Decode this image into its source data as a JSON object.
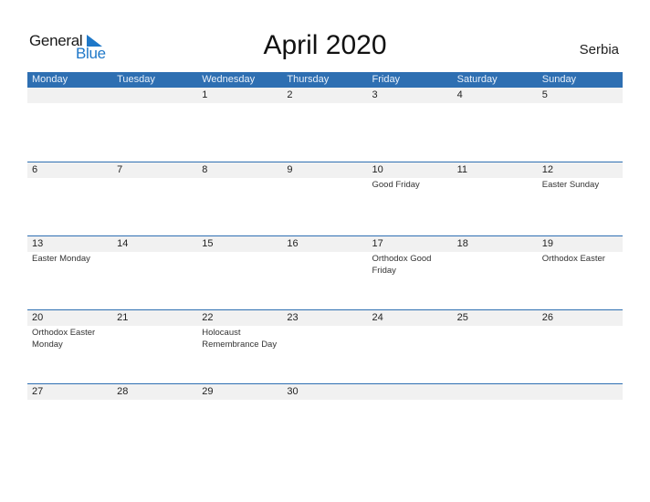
{
  "logo": {
    "part1": "General",
    "part2": "Blue"
  },
  "title": "April 2020",
  "country": "Serbia",
  "colors": {
    "accent": "#2e6fb2",
    "strip": "#f1f1f1",
    "logo_blue": "#1f78c8"
  },
  "weekdays": [
    "Monday",
    "Tuesday",
    "Wednesday",
    "Thursday",
    "Friday",
    "Saturday",
    "Sunday"
  ],
  "weeks": [
    [
      {
        "day": "",
        "holiday": ""
      },
      {
        "day": "",
        "holiday": ""
      },
      {
        "day": "1",
        "holiday": ""
      },
      {
        "day": "2",
        "holiday": ""
      },
      {
        "day": "3",
        "holiday": ""
      },
      {
        "day": "4",
        "holiday": ""
      },
      {
        "day": "5",
        "holiday": ""
      }
    ],
    [
      {
        "day": "6",
        "holiday": ""
      },
      {
        "day": "7",
        "holiday": ""
      },
      {
        "day": "8",
        "holiday": ""
      },
      {
        "day": "9",
        "holiday": ""
      },
      {
        "day": "10",
        "holiday": "Good Friday"
      },
      {
        "day": "11",
        "holiday": ""
      },
      {
        "day": "12",
        "holiday": "Easter Sunday"
      }
    ],
    [
      {
        "day": "13",
        "holiday": "Easter Monday"
      },
      {
        "day": "14",
        "holiday": ""
      },
      {
        "day": "15",
        "holiday": ""
      },
      {
        "day": "16",
        "holiday": ""
      },
      {
        "day": "17",
        "holiday": "Orthodox Good Friday"
      },
      {
        "day": "18",
        "holiday": ""
      },
      {
        "day": "19",
        "holiday": "Orthodox Easter"
      }
    ],
    [
      {
        "day": "20",
        "holiday": "Orthodox Easter Monday"
      },
      {
        "day": "21",
        "holiday": ""
      },
      {
        "day": "22",
        "holiday": "Holocaust Remembrance Day"
      },
      {
        "day": "23",
        "holiday": ""
      },
      {
        "day": "24",
        "holiday": ""
      },
      {
        "day": "25",
        "holiday": ""
      },
      {
        "day": "26",
        "holiday": ""
      }
    ],
    [
      {
        "day": "27",
        "holiday": ""
      },
      {
        "day": "28",
        "holiday": ""
      },
      {
        "day": "29",
        "holiday": ""
      },
      {
        "day": "30",
        "holiday": ""
      },
      {
        "day": "",
        "holiday": ""
      },
      {
        "day": "",
        "holiday": ""
      },
      {
        "day": "",
        "holiday": ""
      }
    ]
  ]
}
